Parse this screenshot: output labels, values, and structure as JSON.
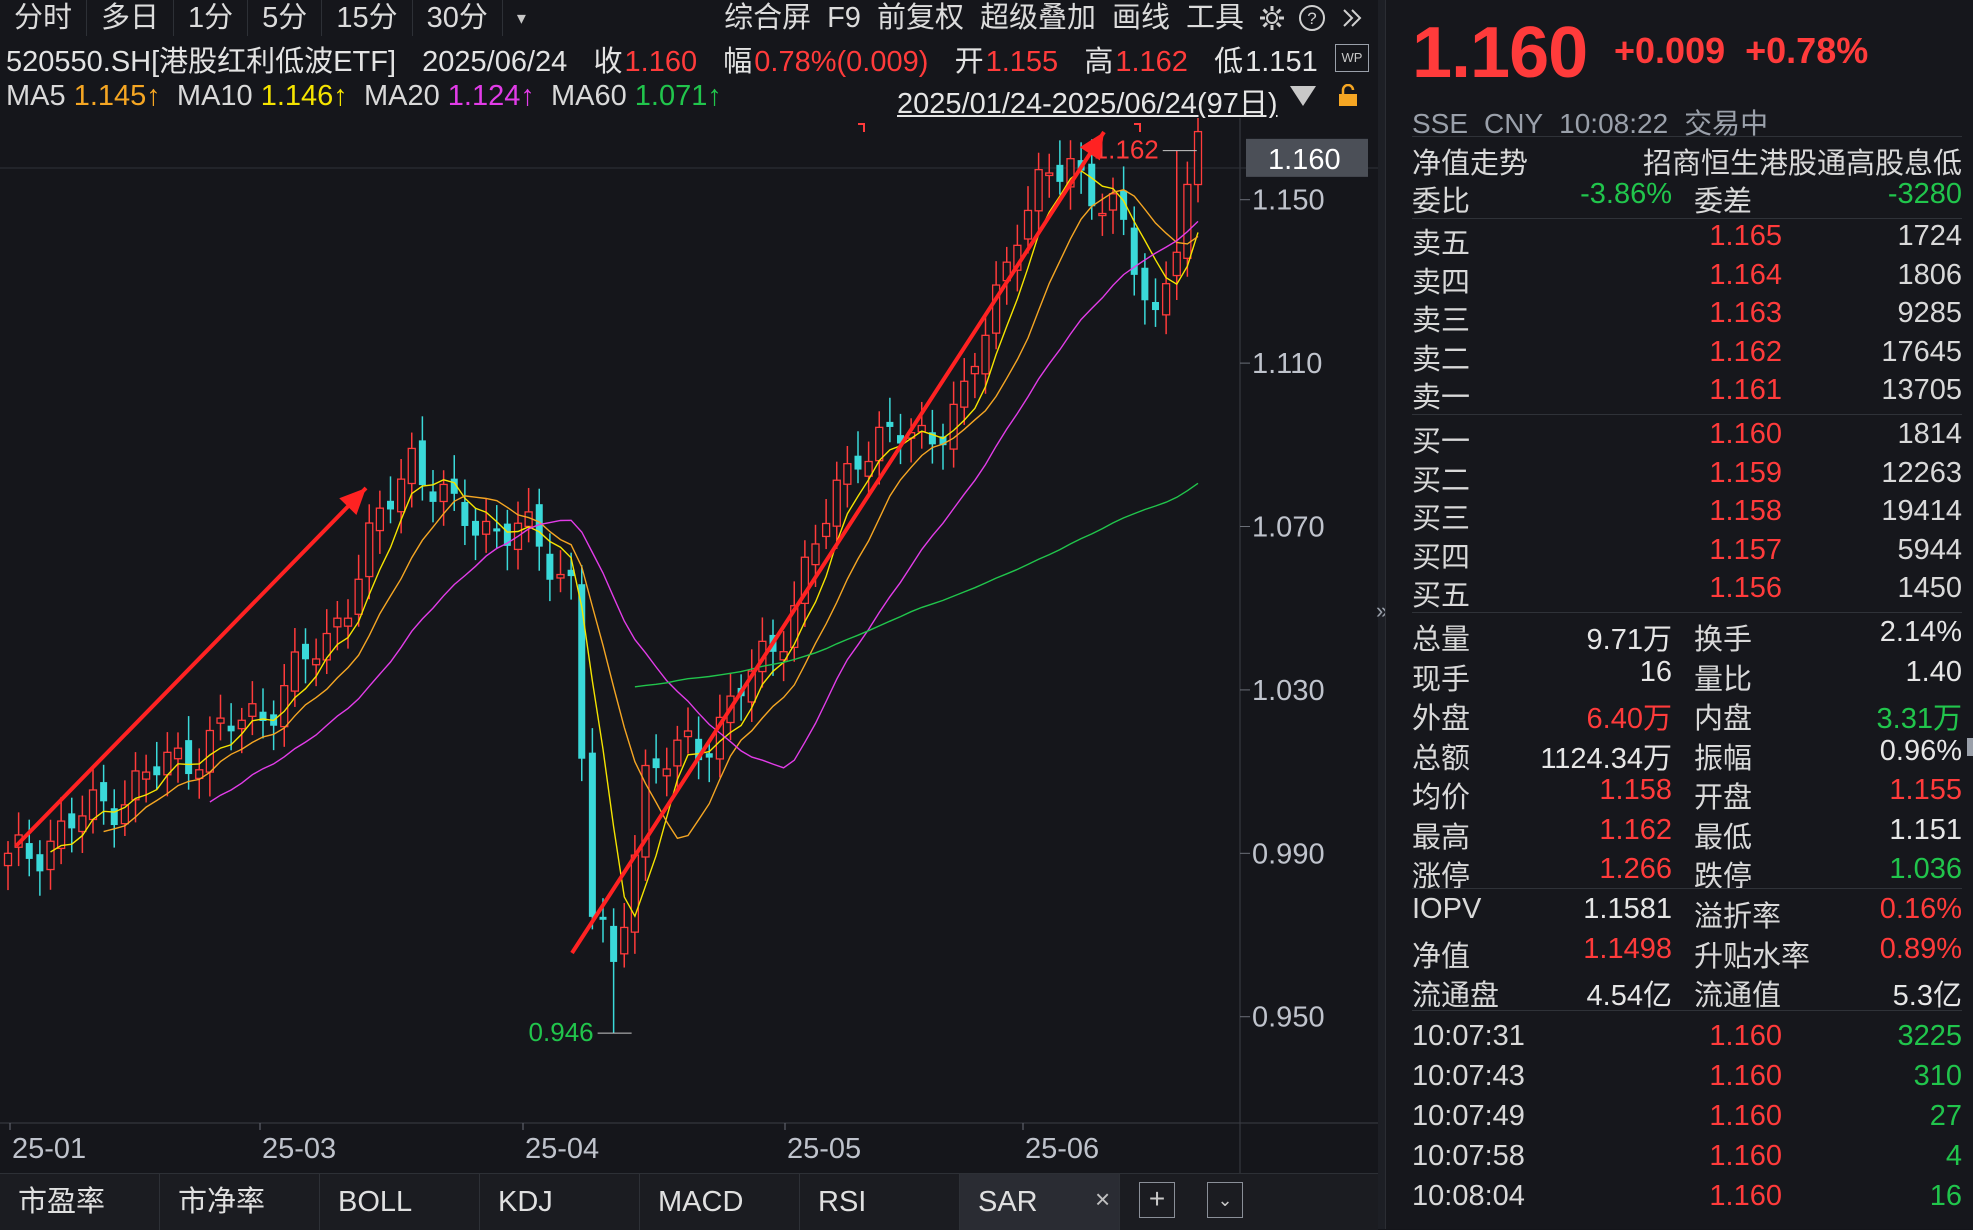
{
  "toolbar": {
    "periods": [
      "分时",
      "多日",
      "1分",
      "5分",
      "15分",
      "30分"
    ],
    "dropdown": "▾",
    "tools": [
      "综合屏",
      "F9",
      "前复权",
      "超级叠加",
      "画线",
      "工具"
    ]
  },
  "info": {
    "code": "520550.SH[港股红利低波ETF]",
    "date": "2025/06/24",
    "close_label": "收",
    "close": "1.160",
    "amp_label": "幅",
    "amp": "0.78%(0.009)",
    "open_label": "开",
    "open": "1.155",
    "high_label": "高",
    "high": "1.162",
    "low_label": "低",
    "low": "1.151",
    "wp": "WP"
  },
  "ma": {
    "ma5_label": "MA5",
    "ma5": "1.145↑",
    "ma10_label": "MA10",
    "ma10": "1.146↑",
    "ma20_label": "MA20",
    "ma20": "1.124↑",
    "ma60_label": "MA60",
    "ma60": "1.071↑",
    "range": "2025/01/24-2025/06/24(97日)"
  },
  "chart_data": {
    "type": "candlestick",
    "ylim": [
      0.935,
      1.17
    ],
    "yticks": [
      "1.150",
      "1.110",
      "1.070",
      "1.030",
      "0.990",
      "0.950"
    ],
    "current_price_label": "1.160",
    "xticks": [
      "25-01",
      "25-03",
      "25-04",
      "25-05",
      "25-06"
    ],
    "high_marker": "1.162",
    "low_marker": "0.946",
    "ma_colors": {
      "MA5": "#f5e400",
      "MA10": "#f5a623",
      "MA20": "#e23ce8",
      "MA60": "#21c54c"
    }
  },
  "bottom_tabs": [
    "市盈率",
    "市净率",
    "BOLL",
    "KDJ",
    "MACD",
    "RSI",
    "SAR"
  ],
  "bottom_icons": {
    "close": "×",
    "add": "+",
    "dropdown": "⌄"
  },
  "quote": {
    "price": "1.160",
    "change": "+0.009",
    "change_pct": "+0.78%",
    "exchange": "SSE",
    "currency": "CNY",
    "time": "10:08:22",
    "status": "交易中",
    "nav_trend_label": "净值走势",
    "index_name": "招商恒生港股通高股息低",
    "weibi_label": "委比",
    "weibi": "-3.86%",
    "weicha_label": "委差",
    "weicha": "-3280"
  },
  "orderbook": {
    "asks": [
      {
        "label": "卖五",
        "price": "1.165",
        "vol": "1724"
      },
      {
        "label": "卖四",
        "price": "1.164",
        "vol": "1806"
      },
      {
        "label": "卖三",
        "price": "1.163",
        "vol": "9285"
      },
      {
        "label": "卖二",
        "price": "1.162",
        "vol": "17645"
      },
      {
        "label": "卖一",
        "price": "1.161",
        "vol": "13705"
      }
    ],
    "bids": [
      {
        "label": "买一",
        "price": "1.160",
        "vol": "1814"
      },
      {
        "label": "买二",
        "price": "1.159",
        "vol": "12263"
      },
      {
        "label": "买三",
        "price": "1.158",
        "vol": "19414"
      },
      {
        "label": "买四",
        "price": "1.157",
        "vol": "5944"
      },
      {
        "label": "买五",
        "price": "1.156",
        "vol": "1450"
      }
    ]
  },
  "stats": [
    {
      "l1": "总量",
      "v1": "9.71万",
      "c1": "white",
      "l2": "换手",
      "v2": "2.14%",
      "c2": "white"
    },
    {
      "l1": "现手",
      "v1": "16",
      "c1": "white",
      "l2": "量比",
      "v2": "1.40",
      "c2": "white"
    },
    {
      "l1": "外盘",
      "v1": "6.40万",
      "c1": "red",
      "l2": "内盘",
      "v2": "3.31万",
      "c2": "green"
    },
    {
      "l1": "总额",
      "v1": "1124.34万",
      "c1": "white",
      "l2": "振幅",
      "v2": "0.96%",
      "c2": "white"
    },
    {
      "l1": "均价",
      "v1": "1.158",
      "c1": "red",
      "l2": "开盘",
      "v2": "1.155",
      "c2": "red"
    },
    {
      "l1": "最高",
      "v1": "1.162",
      "c1": "red",
      "l2": "最低",
      "v2": "1.151",
      "c2": "white"
    },
    {
      "l1": "涨停",
      "v1": "1.266",
      "c1": "red",
      "l2": "跌停",
      "v2": "1.036",
      "c2": "green"
    }
  ],
  "etf_stats": [
    {
      "l1": "IOPV",
      "v1": "1.1581",
      "c1": "white",
      "l2": "溢折率",
      "v2": "0.16%",
      "c2": "red"
    },
    {
      "l1": "净值",
      "v1": "1.1498",
      "c1": "red",
      "l2": "升贴水率",
      "v2": "0.89%",
      "c2": "red"
    },
    {
      "l1": "流通盘",
      "v1": "4.54亿",
      "c1": "white",
      "l2": "流通值",
      "v2": "5.3亿",
      "c2": "white"
    }
  ],
  "ticks": [
    {
      "time": "10:07:31",
      "price": "1.160",
      "vol": "3225"
    },
    {
      "time": "10:07:43",
      "price": "1.160",
      "vol": "310"
    },
    {
      "time": "10:07:49",
      "price": "1.160",
      "vol": "27"
    },
    {
      "time": "10:07:58",
      "price": "1.160",
      "vol": "4"
    },
    {
      "time": "10:08:04",
      "price": "1.160",
      "vol": "16"
    }
  ]
}
